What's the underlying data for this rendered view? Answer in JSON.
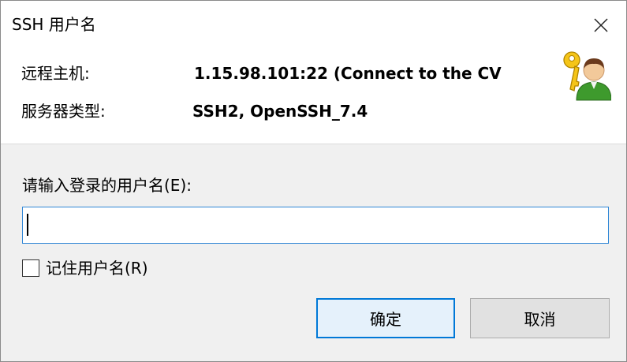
{
  "window": {
    "title": "SSH 用户名"
  },
  "info": {
    "remote_host_label": "远程主机:",
    "remote_host_value": "1.15.98.101:22 (Connect to the CV",
    "server_type_label": "服务器类型:",
    "server_type_value": "SSH2, OpenSSH_7.4"
  },
  "form": {
    "prompt": "请输入登录的用户名(E):",
    "username_value": "",
    "remember_label": "记住用户名(R)",
    "remember_checked": false
  },
  "buttons": {
    "ok_label": "确定",
    "cancel_label": "取消"
  },
  "colors": {
    "focus_border": "#0078d7",
    "input_border": "#2f86d6",
    "dialog_bg": "#f0f0f0"
  }
}
